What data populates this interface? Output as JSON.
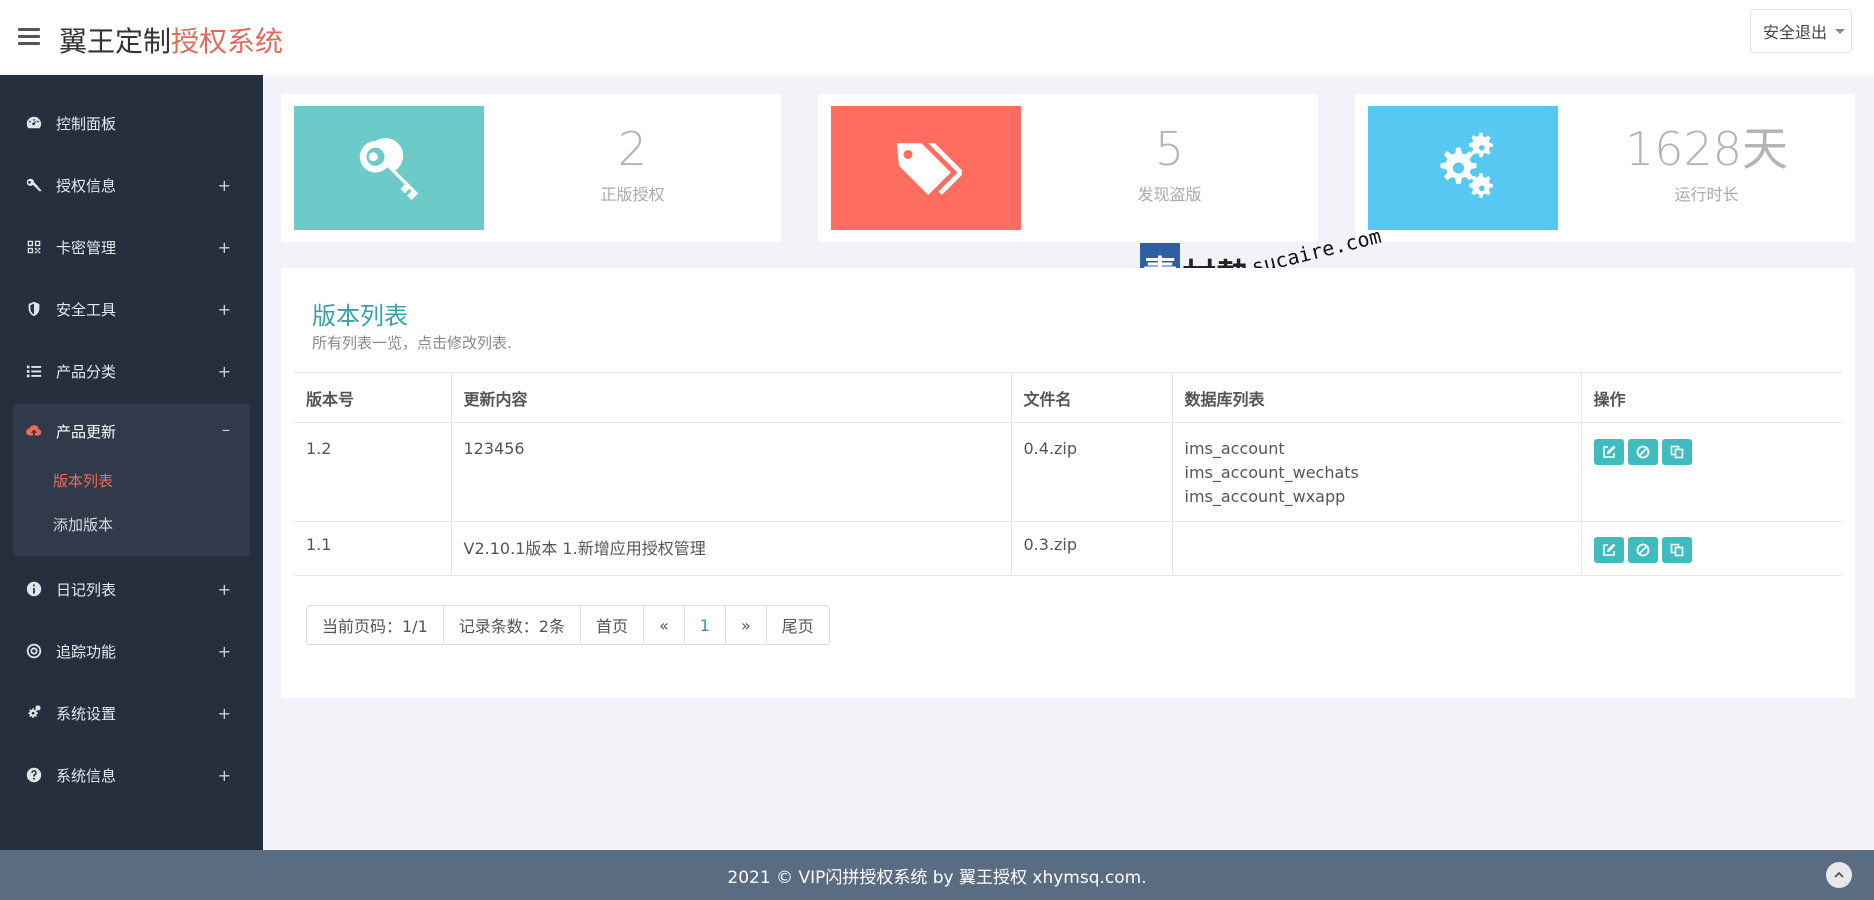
{
  "header": {
    "brand_main": "翼王定制",
    "brand_highlight": "授权系统",
    "logout_label": "安全退出"
  },
  "sidebar": {
    "items": [
      {
        "label": "控制面板",
        "icon": "dashboard-icon",
        "toggle": ""
      },
      {
        "label": "授权信息",
        "icon": "key-icon",
        "toggle": "+"
      },
      {
        "label": "卡密管理",
        "icon": "qrcode-icon",
        "toggle": "+"
      },
      {
        "label": "安全工具",
        "icon": "shield-icon",
        "toggle": "+"
      },
      {
        "label": "产品分类",
        "icon": "list-icon",
        "toggle": "+"
      },
      {
        "label": "产品更新",
        "icon": "cloud-upload-icon",
        "toggle": "–"
      },
      {
        "label": "日记列表",
        "icon": "info-icon",
        "toggle": "+"
      },
      {
        "label": "追踪功能",
        "icon": "target-icon",
        "toggle": "+"
      },
      {
        "label": "系统设置",
        "icon": "cogs-icon",
        "toggle": "+"
      },
      {
        "label": "系统信息",
        "icon": "question-icon",
        "toggle": "+"
      }
    ],
    "submenu": [
      {
        "label": "版本列表",
        "active": true
      },
      {
        "label": "添加版本",
        "active": false
      }
    ]
  },
  "stats": [
    {
      "value": "2",
      "label": "正版授权",
      "color": "#6ccac9",
      "icon": "key-icon"
    },
    {
      "value": "5",
      "label": "发现盗版",
      "color": "#ff6c60",
      "icon": "tags-icon"
    },
    {
      "value": "1628天",
      "label": "运行时长",
      "color": "#57c8f2",
      "icon": "cogs-icon"
    }
  ],
  "panel": {
    "title": "版本列表",
    "subtitle": "所有列表一览，点击修改列表.",
    "columns": [
      "版本号",
      "更新内容",
      "文件名",
      "数据库列表",
      "操作"
    ],
    "rows": [
      {
        "version": "1.2",
        "content": "123456",
        "file": "0.4.zip",
        "db": [
          "ims_account",
          "ims_account_wechats",
          "ims_account_wxapp"
        ]
      },
      {
        "version": "1.1",
        "content": "V2.10.1版本 1.新增应用授权管理",
        "file": "0.3.zip",
        "db": []
      }
    ]
  },
  "pager": {
    "current": "当前页码：1/1",
    "count": "记录条数：2条",
    "first": "首页",
    "prev": "«",
    "page": "1",
    "next": "»",
    "last": "尾页"
  },
  "watermark": {
    "box": "素",
    "cn": "材熱",
    "en": "sucaire.com"
  },
  "footer": {
    "text": "2021 © VIP闪拼授权系统 by 翼王授权 xhymsq.com."
  }
}
